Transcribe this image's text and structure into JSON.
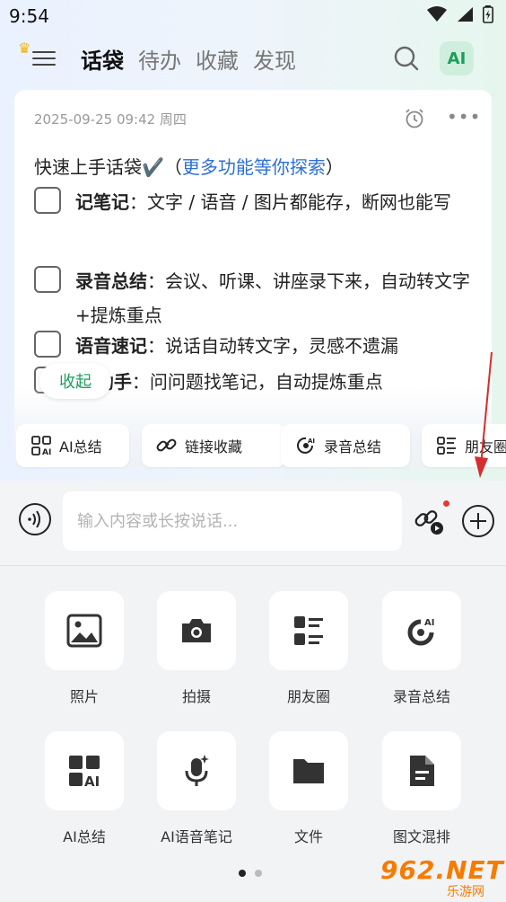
{
  "status_bar": {
    "time": "9:54"
  },
  "nav": {
    "tabs": [
      {
        "label": "话袋",
        "active": true
      },
      {
        "label": "待办",
        "active": false
      },
      {
        "label": "收藏",
        "active": false
      },
      {
        "label": "发现",
        "active": false
      }
    ],
    "ai_label": "AI"
  },
  "note": {
    "date": "2025-09-25 09:42 周四",
    "title": "快速上手话袋✔️（",
    "title_link": "更多功能等你探索",
    "title_end": "）",
    "items": [
      {
        "bold": "记笔记",
        "text": "：文字 / 语音 / 图片都能存，断网也能写"
      },
      {
        "bold": "录音总结",
        "text": "：会议、听课、讲座录下来，自动转文字+提炼重点"
      },
      {
        "bold": "语音速记",
        "text": "：说话自动转文字，灵感不遗漏"
      },
      {
        "bold": "AI助手",
        "text": "：问问题找笔记，自动提炼重点"
      }
    ],
    "collapse_label": "收起"
  },
  "quick_actions": [
    "AI总结",
    "链接收藏",
    "录音总结",
    "朋友圈"
  ],
  "input": {
    "placeholder": "输入内容或长按说话..."
  },
  "grid": [
    {
      "label": "照片",
      "icon": "image-icon"
    },
    {
      "label": "拍摄",
      "icon": "camera-icon"
    },
    {
      "label": "朋友圈",
      "icon": "moments-icon"
    },
    {
      "label": "录音总结",
      "icon": "record-summary-icon"
    },
    {
      "label": "AI总结",
      "icon": "ai-summary-icon"
    },
    {
      "label": "AI语音笔记",
      "icon": "ai-voice-note-icon"
    },
    {
      "label": "文件",
      "icon": "folder-icon"
    },
    {
      "label": "图文混排",
      "icon": "document-icon"
    }
  ],
  "pager": {
    "pages": 2,
    "current": 1
  },
  "watermark": {
    "main": "962.NET",
    "sub": "乐游网"
  },
  "colors": {
    "accent_green": "#1d9e5a",
    "link_blue": "#2d6fd6",
    "arrow_red": "#d32f2f"
  }
}
